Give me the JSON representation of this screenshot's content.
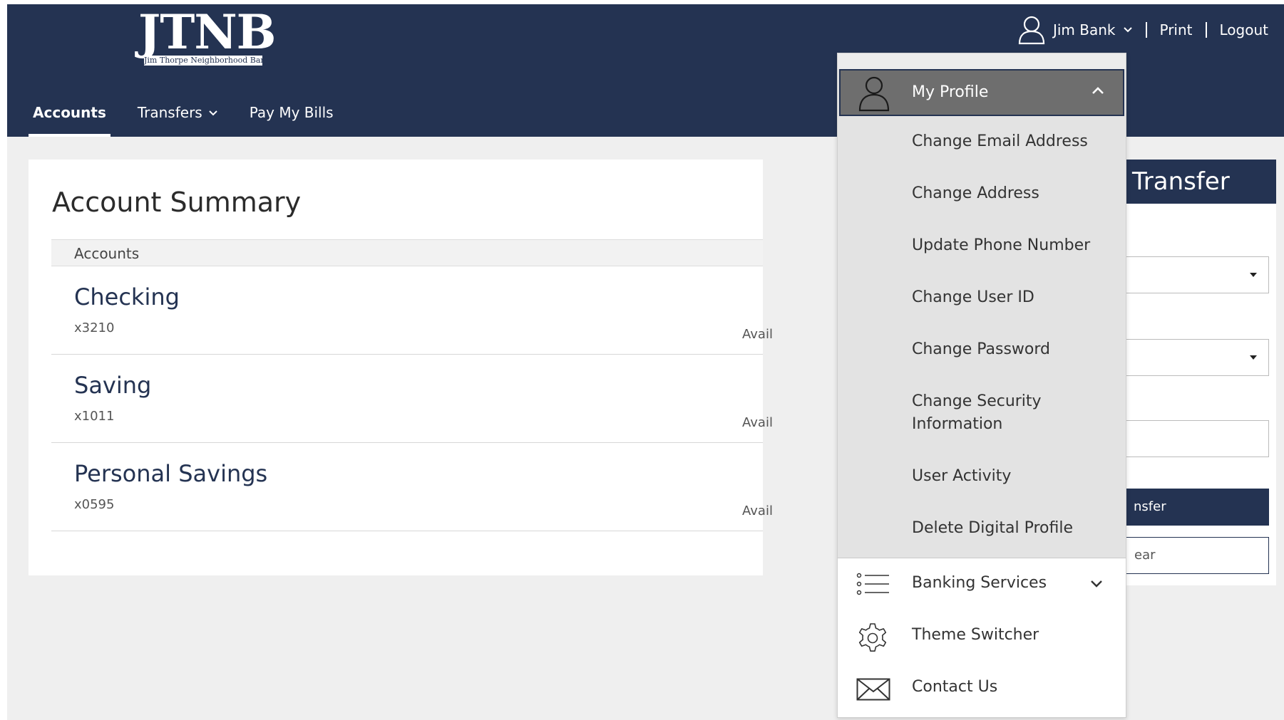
{
  "brand": {
    "logo_text": "JTNB",
    "logo_subtitle": "Jim Thorpe Neighborhood Bank"
  },
  "topbar": {
    "user_name": "Jim Bank",
    "print_label": "Print",
    "logout_label": "Logout"
  },
  "nav": {
    "items": [
      {
        "label": "Accounts",
        "active": true
      },
      {
        "label": "Transfers",
        "has_dropdown": true
      },
      {
        "label": "Pay My Bills"
      }
    ]
  },
  "summary": {
    "title": "Account Summary",
    "list_header": "Accounts",
    "accounts": [
      {
        "name": "Checking",
        "number": "x3210",
        "avail_label": "Avail"
      },
      {
        "name": "Saving",
        "number": "x1011",
        "avail_label": "Avail"
      },
      {
        "name": "Personal Savings",
        "number": "x0595",
        "avail_label": "Avail"
      }
    ]
  },
  "transfer": {
    "title_visible": "Transfer",
    "submit_visible": "nsfer",
    "clear_visible": "ear"
  },
  "dropdown": {
    "profile_label": "My Profile",
    "profile_items": [
      "Change Email Address",
      "Change Address",
      "Update Phone Number",
      "Change User ID",
      "Change Password",
      "Change Security Information",
      "User Activity",
      "Delete Digital Profile"
    ],
    "banking_services_label": "Banking Services",
    "theme_switcher_label": "Theme Switcher",
    "contact_us_label": "Contact Us"
  },
  "colors": {
    "navy": "#243352",
    "page_bg": "#efefef",
    "menu_bg": "#e3e3e3",
    "profile_active_bg": "#6e6e6e"
  },
  "icons": [
    "user-icon",
    "chevron-down-icon",
    "chevron-up-icon",
    "list-icon",
    "gear-icon",
    "envelope-icon",
    "caret-down-icon"
  ]
}
